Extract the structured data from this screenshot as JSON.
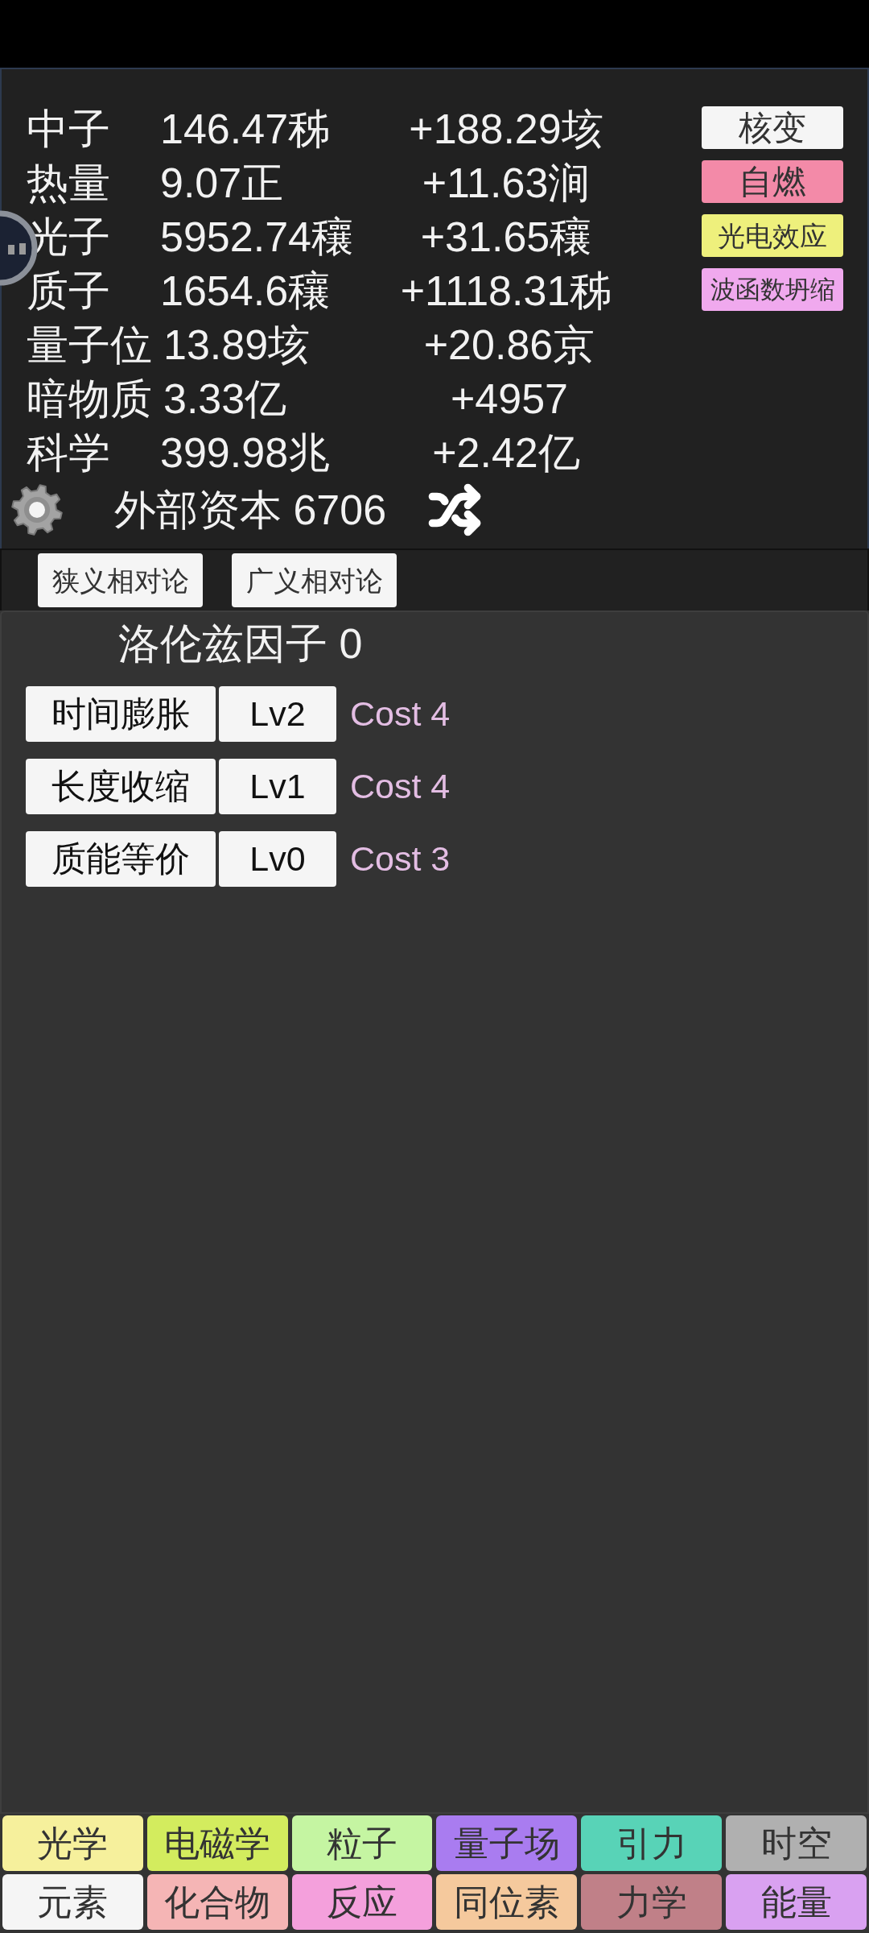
{
  "resources": [
    {
      "name": "中子",
      "amount": "146.47秭",
      "rate": "+188.29垓"
    },
    {
      "name": "热量",
      "amount": "9.07正",
      "rate": "+11.63涧"
    },
    {
      "name": "光子",
      "amount": "5952.74穰",
      "rate": "+31.65穰"
    },
    {
      "name": "质子",
      "amount": "1654.6穰",
      "rate": "+1118.31秭"
    },
    {
      "name": "量子位",
      "amount": "13.89垓",
      "rate": "+20.86京"
    },
    {
      "name": "暗物质",
      "amount": "3.33亿",
      "rate": "+4957"
    },
    {
      "name": "科学",
      "amount": "399.98兆",
      "rate": "+2.42亿"
    }
  ],
  "actions": [
    {
      "label": "核变",
      "color": "#f5f5f5"
    },
    {
      "label": "自燃",
      "color": "#f38aa8"
    },
    {
      "label": "光电效应",
      "color": "#eef07c"
    },
    {
      "label": "波函数坍缩",
      "color": "#f0a9ee"
    }
  ],
  "capital": "外部资本 6706",
  "tabs": [
    {
      "label": "狭义相对论"
    },
    {
      "label": "广义相对论"
    }
  ],
  "lorentz_factor": "洛伦兹因子 0",
  "upgrades": [
    {
      "name": "时间膨胀",
      "lv": "Lv2",
      "cost": "Cost 4"
    },
    {
      "name": "长度收缩",
      "lv": "Lv1",
      "cost": "Cost 4"
    },
    {
      "name": "质能等价",
      "lv": "Lv0",
      "cost": "Cost 3"
    }
  ],
  "bottom_nav": [
    {
      "label": "光学",
      "color": "#f6f09c"
    },
    {
      "label": "电磁学",
      "color": "#d3ec5e"
    },
    {
      "label": "粒子",
      "color": "#c5f5a2"
    },
    {
      "label": "量子场",
      "color": "#a97cf0"
    },
    {
      "label": "引力",
      "color": "#58d3b7"
    },
    {
      "label": "时空",
      "color": "#b0b0b0"
    },
    {
      "label": "元素",
      "color": "#f5f5f5"
    },
    {
      "label": "化合物",
      "color": "#f5b5b5"
    },
    {
      "label": "反应",
      "color": "#f4a0dc"
    },
    {
      "label": "同位素",
      "color": "#f5c99d"
    },
    {
      "label": "力学",
      "color": "#c08088"
    },
    {
      "label": "能量",
      "color": "#d9a1f1"
    }
  ]
}
